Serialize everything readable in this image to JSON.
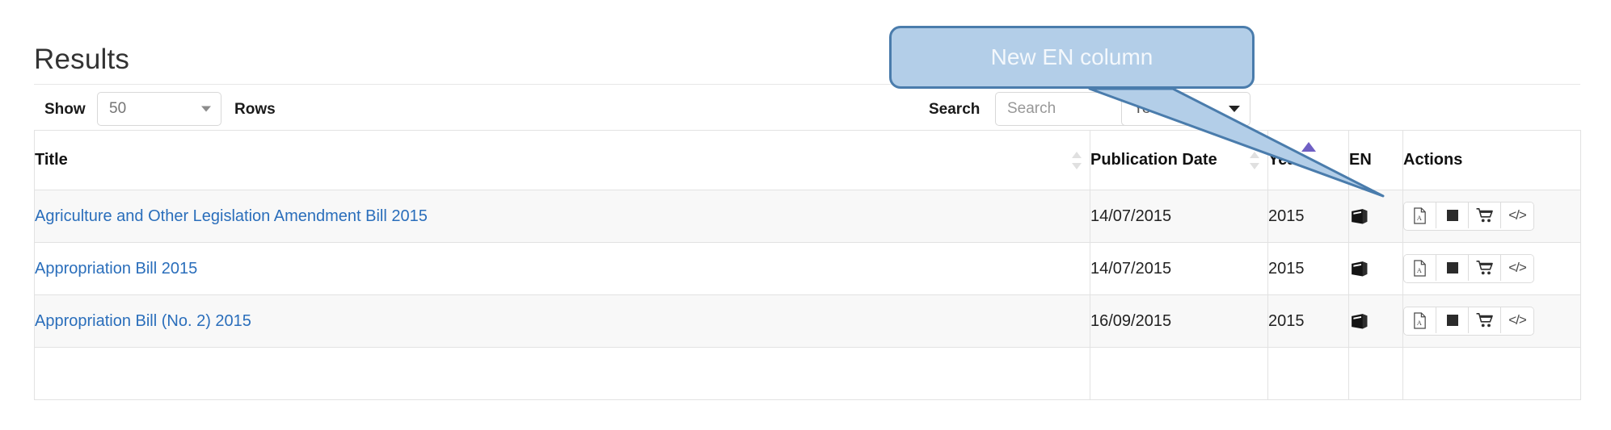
{
  "page": {
    "heading": "Results"
  },
  "toolbar": {
    "show_label": "Show",
    "rows_label": "Rows",
    "rows_value": "50",
    "search_label": "Search",
    "search_value": "",
    "search_placeholder": "Search",
    "year_value": "Year",
    "rows_caret_icon": "chevron-down-icon",
    "year_caret_icon": "chevron-down-icon"
  },
  "callout": {
    "text": "New EN column",
    "fill_color": "#b3cee8",
    "border_color": "#4a7cac",
    "text_color": "#f4f8fc"
  },
  "table": {
    "columns": [
      {
        "key": "title",
        "label": "Title",
        "sortable": true,
        "sort_state": "none"
      },
      {
        "key": "pubdate",
        "label": "Publication Date",
        "sortable": true,
        "sort_state": "none"
      },
      {
        "key": "year",
        "label": "Year",
        "sortable": true,
        "sort_state": "asc"
      },
      {
        "key": "en",
        "label": "EN",
        "sortable": false,
        "sort_state": "none"
      },
      {
        "key": "actions",
        "label": "Actions",
        "sortable": false,
        "sort_state": "none"
      }
    ],
    "rows": [
      {
        "title": "Agriculture and Other Legislation Amendment Bill 2015",
        "pubdate": "14/07/2015",
        "year": "2015",
        "en_icon": "book-icon",
        "actions": [
          "pdf-file-icon",
          "black-square-icon",
          "shopping-cart-icon",
          "code-icon"
        ]
      },
      {
        "title": "Appropriation Bill 2015",
        "pubdate": "14/07/2015",
        "year": "2015",
        "en_icon": "book-icon",
        "actions": [
          "pdf-file-icon",
          "black-square-icon",
          "shopping-cart-icon",
          "code-icon"
        ]
      },
      {
        "title": "Appropriation Bill (No. 2) 2015",
        "pubdate": "16/09/2015",
        "year": "2015",
        "en_icon": "book-icon",
        "actions": [
          "pdf-file-icon",
          "black-square-icon",
          "shopping-cart-icon",
          "code-icon"
        ]
      },
      {
        "title": "",
        "pubdate": "",
        "year": "",
        "en_icon": "",
        "actions": []
      }
    ]
  },
  "colors": {
    "link": "#2a6ebb",
    "sort_active": "#6f5fc4",
    "stripe": "#f8f8f8",
    "border": "#e2e2e2"
  }
}
